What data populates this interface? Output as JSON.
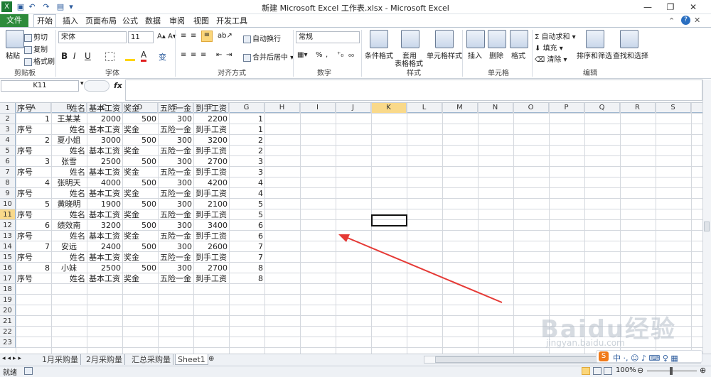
{
  "window": {
    "title": "新建 Microsoft Excel 工作表.xlsx - Microsoft Excel"
  },
  "tabs": {
    "file": "文件",
    "home": "开始",
    "items": [
      "插入",
      "页面布局",
      "公式",
      "数据",
      "审阅",
      "视图",
      "开发工具"
    ]
  },
  "ribbon": {
    "clipboard": {
      "group": "剪贴板",
      "paste": "粘贴",
      "cut": "剪切",
      "copy": "复制",
      "format_painter": "格式刷"
    },
    "font": {
      "group": "字体",
      "name": "宋体",
      "size": "11",
      "bold": "B",
      "italic": "I",
      "underline": "U",
      "fontcolor": "A",
      "wen": "变"
    },
    "align": {
      "group": "对齐方式",
      "wrap": "自动换行",
      "merge": "合并后居中"
    },
    "number": {
      "group": "数字",
      "format": "常规",
      "percent": "%"
    },
    "styles": {
      "group": "样式",
      "cond": "条件格式",
      "table_l1": "套用",
      "table_l2": "表格格式",
      "cell": "单元格样式"
    },
    "cells": {
      "group": "单元格",
      "insert": "插入",
      "delete": "删除",
      "format": "格式"
    },
    "edit": {
      "group": "编辑",
      "autosum": "自动求和",
      "fill": "填充",
      "clear": "清除",
      "sort": "排序和筛选",
      "find": "查找和选择"
    }
  },
  "formula": {
    "namebox": "K11",
    "fx": "fx",
    "content": ""
  },
  "columns": [
    "A",
    "B",
    "C",
    "D",
    "E",
    "F",
    "G",
    "H",
    "I",
    "J",
    "K",
    "L",
    "M",
    "N",
    "O",
    "P",
    "Q",
    "R",
    "S"
  ],
  "rows": [
    [
      "序号",
      "姓名",
      "基本工资",
      "奖金",
      "五险一金",
      "到手工资",
      ""
    ],
    [
      "1",
      "王某某",
      "2000",
      "500",
      "300",
      "2200",
      "1"
    ],
    [
      "序号",
      "姓名",
      "基本工资",
      "奖金",
      "五险一金",
      "到手工资",
      "1"
    ],
    [
      "2",
      "夏小姐",
      "3000",
      "500",
      "300",
      "3200",
      "2"
    ],
    [
      "序号",
      "姓名",
      "基本工资",
      "奖金",
      "五险一金",
      "到手工资",
      "2"
    ],
    [
      "3",
      "张雪",
      "2500",
      "500",
      "300",
      "2700",
      "3"
    ],
    [
      "序号",
      "姓名",
      "基本工资",
      "奖金",
      "五险一金",
      "到手工资",
      "3"
    ],
    [
      "4",
      "张明天",
      "4000",
      "500",
      "300",
      "4200",
      "4"
    ],
    [
      "序号",
      "姓名",
      "基本工资",
      "奖金",
      "五险一金",
      "到手工资",
      "4"
    ],
    [
      "5",
      "黄晓明",
      "1900",
      "500",
      "300",
      "2100",
      "5"
    ],
    [
      "序号",
      "姓名",
      "基本工资",
      "奖金",
      "五险一金",
      "到手工资",
      "5"
    ],
    [
      "6",
      "绩效南",
      "3200",
      "500",
      "300",
      "3400",
      "6"
    ],
    [
      "序号",
      "姓名",
      "基本工资",
      "奖金",
      "五险一金",
      "到手工资",
      "6"
    ],
    [
      "7",
      "安远",
      "2400",
      "500",
      "300",
      "2600",
      "7"
    ],
    [
      "序号",
      "姓名",
      "基本工资",
      "奖金",
      "五险一金",
      "到手工资",
      "7"
    ],
    [
      "8",
      "小妹",
      "2500",
      "500",
      "300",
      "2700",
      "8"
    ],
    [
      "序号",
      "姓名",
      "基本工资",
      "奖金",
      "五险一金",
      "到手工资",
      "8"
    ],
    [
      "",
      "",
      "",
      "",
      "",
      "",
      ""
    ],
    [
      "",
      "",
      "",
      "",
      "",
      "",
      ""
    ],
    [
      "",
      "",
      "",
      "",
      "",
      "",
      ""
    ],
    [
      "",
      "",
      "",
      "",
      "",
      "",
      ""
    ],
    [
      "",
      "",
      "",
      "",
      "",
      "",
      ""
    ],
    [
      "",
      "",
      "",
      "",
      "",
      "",
      ""
    ]
  ],
  "row_numbers": [
    "1",
    "2",
    "3",
    "4",
    "5",
    "6",
    "7",
    "8",
    "9",
    "10",
    "11",
    "12",
    "13",
    "14",
    "15",
    "16",
    "17",
    "18",
    "19",
    "20",
    "21",
    "22",
    "23"
  ],
  "sheets": [
    "1月采购量",
    "2月采购量",
    "汇总采购量",
    "Sheet1"
  ],
  "status": {
    "ready": "就绪",
    "zoom": "100%"
  },
  "selection": {
    "cell": "K11",
    "color": "#000000"
  },
  "annotation": {
    "arrow_color": "#e53935"
  },
  "watermark": {
    "line1": "Baidu经验",
    "line2": "jingyan.baidu.com"
  },
  "colors": {
    "file_tab": "#2e8b3b",
    "header_highlight": "#f9d98a"
  }
}
